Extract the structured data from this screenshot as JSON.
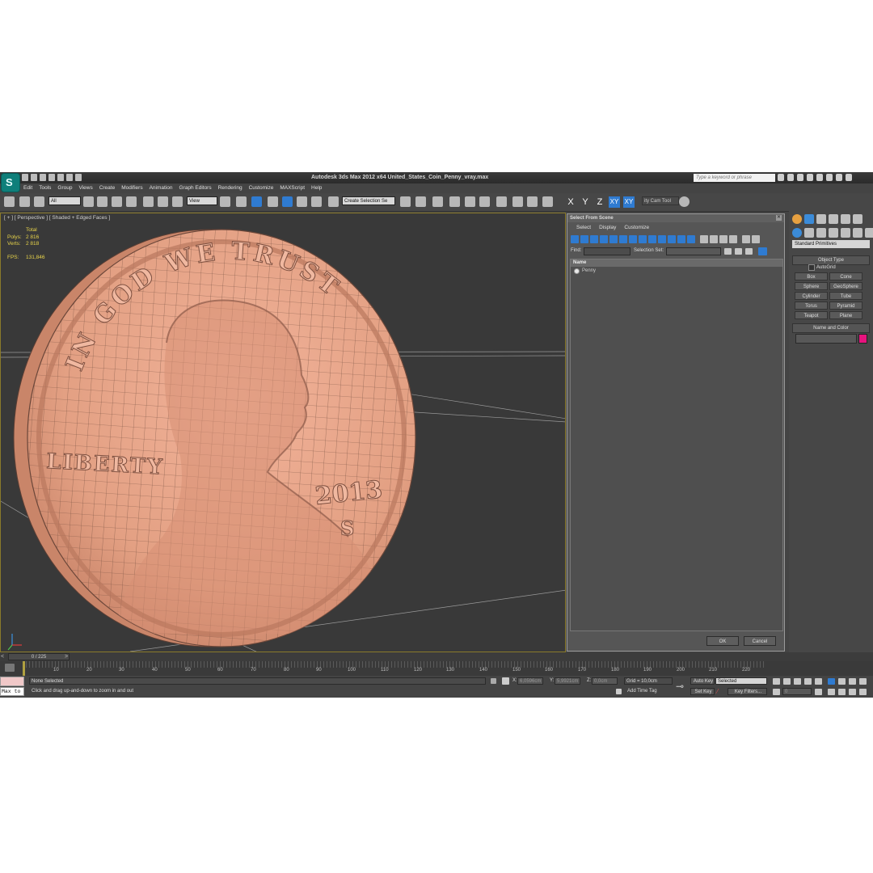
{
  "window": {
    "title": "Autodesk 3ds Max  2012 x64     United_States_Coin_Penny_vray.max",
    "search_placeholder": "Type a keyword or phrase"
  },
  "menu": [
    "Edit",
    "Tools",
    "Group",
    "Views",
    "Create",
    "Modifiers",
    "Animation",
    "Graph Editors",
    "Rendering",
    "Customize",
    "MAXScript",
    "Help"
  ],
  "toolbar": {
    "filter_value": "All",
    "refcoord_value": "View",
    "selection_set_value": "Create Selection Se",
    "axis_x": "X",
    "axis_y": "Y",
    "axis_z": "Z",
    "axis_xy": "XY",
    "axis_xy2": "XY",
    "extra_tool": "ity Cam Tool"
  },
  "viewport": {
    "label": "[ + ] [ Perspective ] [ Shaded + Edged Faces ]",
    "stats": {
      "header": "Total",
      "polys_label": "Polys:",
      "polys_value": "2 816",
      "verts_label": "Verts:",
      "verts_value": "2 818",
      "fps_label": "FPS:",
      "fps_value": "131,846"
    },
    "coin": {
      "motto": "IN GOD WE TRUST",
      "liberty": "LIBERTY",
      "year": "2013",
      "mint_mark": "S",
      "color": "#e4a287"
    }
  },
  "dialog": {
    "title": "Select From Scene",
    "menu": [
      "Select",
      "Display",
      "Customize"
    ],
    "find_label": "Find:",
    "selection_set_label": "Selection Set:",
    "column_header": "Name",
    "items": [
      "Penny"
    ],
    "ok_label": "OK",
    "cancel_label": "Cancel"
  },
  "command_panel": {
    "category": "Standard Primitives",
    "object_type_title": "Object Type",
    "autogrid_label": "AutoGrid",
    "primitives": [
      "Box",
      "Cone",
      "Sphere",
      "GeoSphere",
      "Cylinder",
      "Tube",
      "Torus",
      "Pyramid",
      "Teapot",
      "Plane"
    ],
    "name_color_title": "Name and Color",
    "object_color": "#e6137e"
  },
  "timeline": {
    "frame_display": "0 / 225",
    "ticks": [
      "10",
      "20",
      "30",
      "40",
      "50",
      "60",
      "70",
      "80",
      "90",
      "100",
      "110",
      "120",
      "130",
      "140",
      "150",
      "160",
      "170",
      "180",
      "190",
      "200",
      "210",
      "220"
    ]
  },
  "status": {
    "maxscript_text": "Max to",
    "selection_status": "None Selected",
    "prompt": "Click and drag up-and-down to zoom in and out",
    "x_label": "X:",
    "x_value": "6,0596cm",
    "y_label": "Y:",
    "y_value": "5,9921cm",
    "z_label": "Z:",
    "z_value": "0,0cm",
    "grid": "Grid = 10,0cm",
    "add_time_tag": "Add Time Tag",
    "auto_key": "Auto Key",
    "set_key": "Set Key",
    "key_mode": "Selected",
    "key_filters": "Key Filters...",
    "current_frame": "0"
  }
}
